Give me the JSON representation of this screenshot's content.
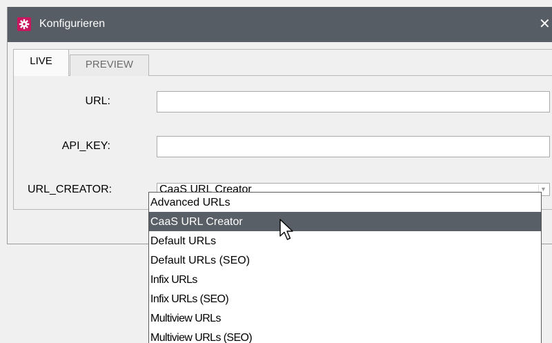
{
  "window": {
    "title": "Konfigurieren",
    "close_symbol": "✕"
  },
  "tabs": [
    {
      "label": "LIVE",
      "active": true
    },
    {
      "label": "PREVIEW",
      "active": false
    }
  ],
  "form": {
    "url_label": "URL:",
    "url_value": "",
    "api_key_label": "API_KEY:",
    "api_key_value": "",
    "url_creator_label": "URL_CREATOR:",
    "url_creator_value": "CaaS URL Creator"
  },
  "dropdown": {
    "options": [
      "Advanced URLs",
      "CaaS URL Creator",
      "Default URLs",
      "Default URLs (SEO)",
      "Infix URLs",
      "Infix URLs (SEO)",
      "Multiview URLs",
      "Multiview URLs (SEO)"
    ],
    "highlighted_index": 1
  },
  "colors": {
    "titlebar": "#565d64",
    "app_icon": "#c8175f",
    "highlight": "#595f66"
  }
}
